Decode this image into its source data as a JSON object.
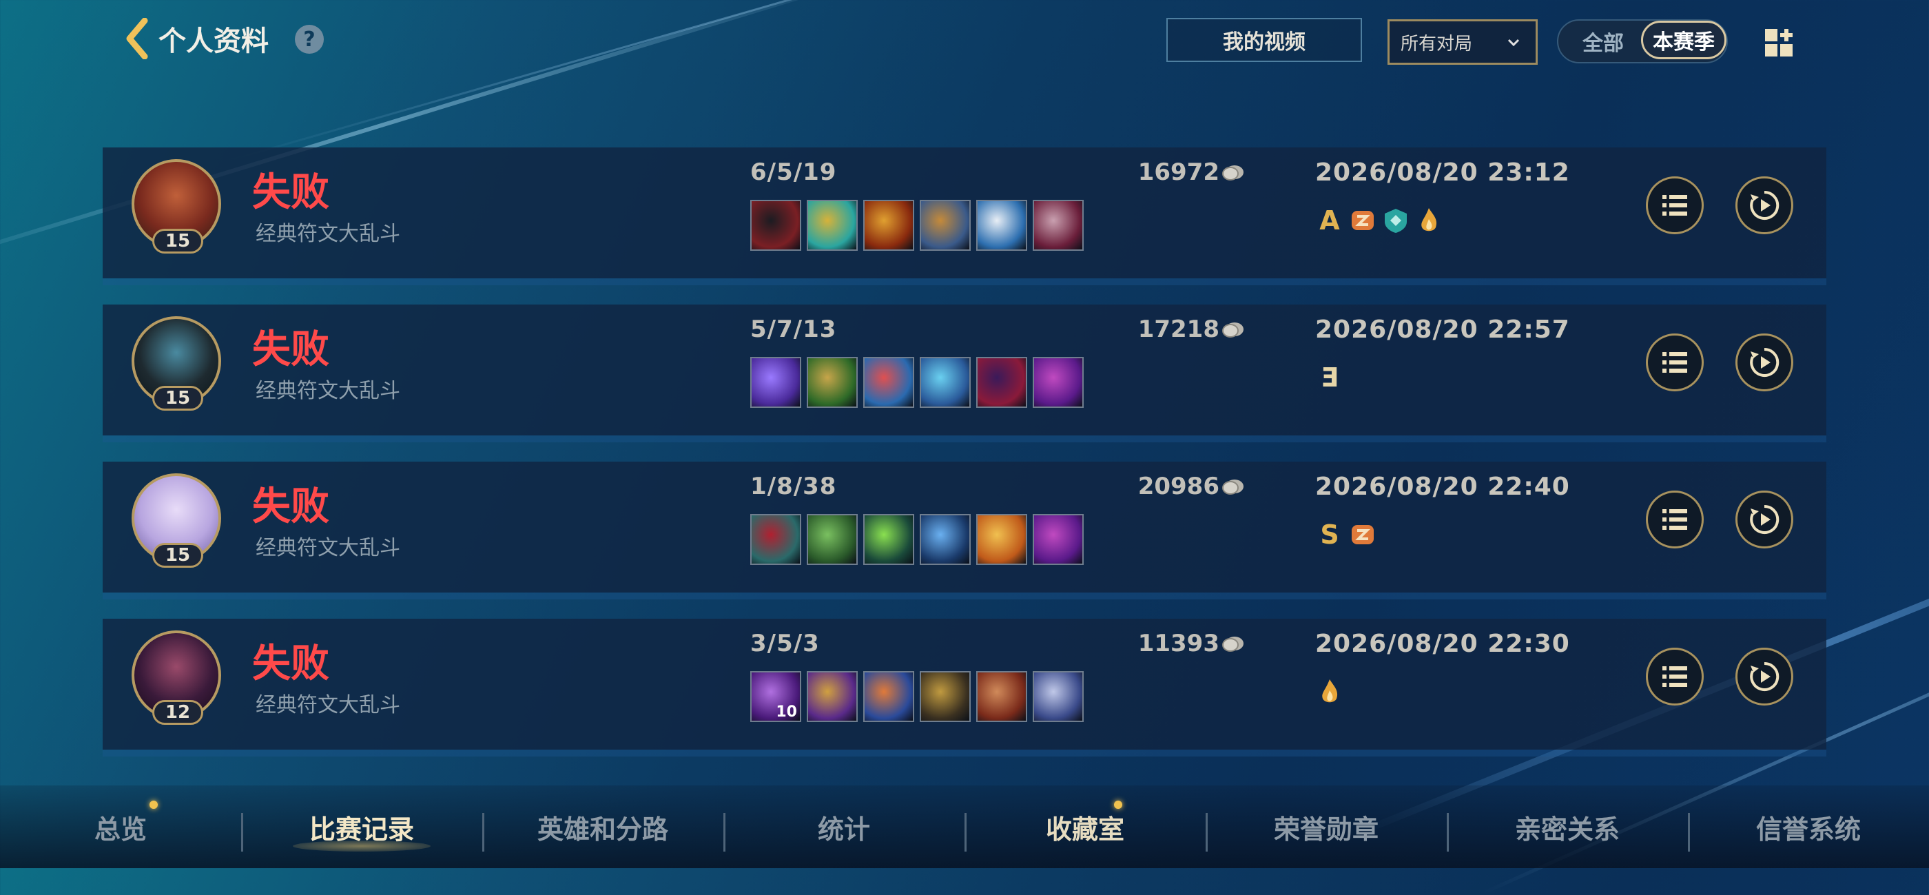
{
  "header": {
    "title": "个人资料",
    "help": "?",
    "video_button": "我的视频",
    "match_filter": "所有对局",
    "season_toggle": {
      "all": "全部",
      "season": "本赛季",
      "selected": "本赛季"
    }
  },
  "matches": [
    {
      "result": "失败",
      "mode": "经典符文大乱斗",
      "level": "15",
      "kda": "6/5/19",
      "gold": "16972",
      "datetime": "2026/08/20 23:12",
      "champion_icon": "monkey-king-portrait",
      "items": [
        {
          "icon": "axe-item-icon",
          "colors": [
            "#7a1f24",
            "#1c1c22"
          ]
        },
        {
          "icon": "gold-sigil-item-icon",
          "colors": [
            "#2aa5a0",
            "#d6b23a"
          ]
        },
        {
          "icon": "flame-blade-item-icon",
          "colors": [
            "#8a2a0e",
            "#e0a030"
          ]
        },
        {
          "icon": "armor-item-icon",
          "colors": [
            "#3a5a8a",
            "#c58a3a"
          ]
        },
        {
          "icon": "white-blade-item-icon",
          "colors": [
            "#2d6fb0",
            "#e8eef5"
          ]
        },
        {
          "icon": "boots-item-icon",
          "colors": [
            "#6a1e3a",
            "#c9a0b0"
          ]
        }
      ],
      "badges": [
        "A",
        "emblem-orange",
        "shield-teal",
        "flame"
      ]
    },
    {
      "result": "失败",
      "mode": "经典符文大乱斗",
      "level": "15",
      "kda": "5/7/13",
      "gold": "17218",
      "datetime": "2026/08/20 22:57",
      "champion_icon": "dark-warrior-portrait",
      "items": [
        {
          "icon": "arcane-orb-item-icon",
          "colors": [
            "#4a2a9a",
            "#9a7aff"
          ]
        },
        {
          "icon": "nature-shield-item-icon",
          "colors": [
            "#2e6a28",
            "#c7a54a"
          ]
        },
        {
          "icon": "mask-item-icon",
          "colors": [
            "#2a6ab0",
            "#e05050"
          ]
        },
        {
          "icon": "crystal-scepter-item-icon",
          "colors": [
            "#2a5a9a",
            "#6ad0f0"
          ]
        },
        {
          "icon": "crimson-hood-item-icon",
          "colors": [
            "#8a1a3a",
            "#3a1a5a"
          ]
        },
        {
          "icon": "arcane-boots-item-icon",
          "colors": [
            "#5a1a8a",
            "#c04ac0"
          ]
        }
      ],
      "badges": [
        "E"
      ]
    },
    {
      "result": "失败",
      "mode": "经典符文大乱斗",
      "level": "15",
      "kda": "1/8/38",
      "gold": "20986",
      "datetime": "2026/08/20 22:40",
      "champion_icon": "lavender-mage-portrait",
      "items": [
        {
          "icon": "dark-helm-item-icon",
          "colors": [
            "#2a6a6a",
            "#b02030"
          ]
        },
        {
          "icon": "thorn-plate-item-icon",
          "colors": [
            "#2a5a2a",
            "#7ac060"
          ]
        },
        {
          "icon": "verdant-crest-item-icon",
          "colors": [
            "#1a4a3a",
            "#8ae050"
          ]
        },
        {
          "icon": "trident-item-icon",
          "colors": [
            "#1a3a6a",
            "#6ab0f0"
          ]
        },
        {
          "icon": "sun-emblem-item-icon",
          "colors": [
            "#c05a1a",
            "#f0c050"
          ]
        },
        {
          "icon": "arcane-boots-item-icon",
          "colors": [
            "#5a1a8a",
            "#c04ac0"
          ]
        }
      ],
      "badges": [
        "S",
        "emblem-orange"
      ]
    },
    {
      "result": "失败",
      "mode": "经典符文大乱斗",
      "level": "12",
      "kda": "3/5/3",
      "gold": "11393",
      "datetime": "2026/08/20 22:30",
      "champion_icon": "shadow-assassin-portrait",
      "items": [
        {
          "icon": "violet-orb-item-icon",
          "colors": [
            "#4a1a7a",
            "#b070e0"
          ],
          "count": "10"
        },
        {
          "icon": "mage-hat-item-icon",
          "colors": [
            "#5a2a8a",
            "#d0a040"
          ]
        },
        {
          "icon": "spell-sigil-item-icon",
          "colors": [
            "#2a4a9a",
            "#e07a3a"
          ]
        },
        {
          "icon": "gold-mantle-item-icon",
          "colors": [
            "#3a3020",
            "#c09a40"
          ]
        },
        {
          "icon": "tome-item-icon",
          "colors": [
            "#7a2a1a",
            "#d08a5a"
          ]
        },
        {
          "icon": "swift-boots-item-icon",
          "colors": [
            "#3a4a8a",
            "#c0c8e8"
          ]
        }
      ],
      "badges": [
        "flame"
      ]
    }
  ],
  "nav": {
    "tabs": [
      {
        "label": "总览",
        "dot": true
      },
      {
        "label": "比赛记录",
        "active": true
      },
      {
        "label": "英雄和分路"
      },
      {
        "label": "统计"
      },
      {
        "label": "收藏室",
        "dot": true
      },
      {
        "label": "荣誉勋章"
      },
      {
        "label": "亲密关系"
      },
      {
        "label": "信誉系统"
      }
    ]
  },
  "colors": {
    "defeat": "#ff4a4a",
    "gold_accent": "#b79b62",
    "badge_gold": "#e0b352"
  }
}
